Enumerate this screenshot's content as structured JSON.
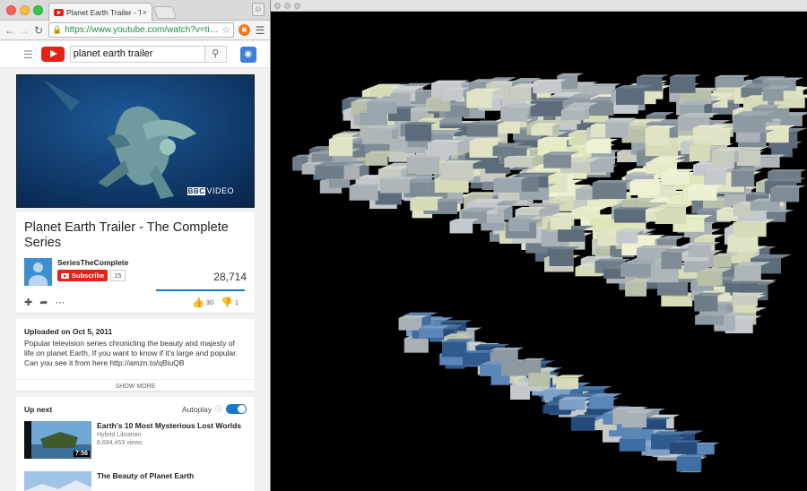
{
  "browser": {
    "tab_title": "Planet Earth Trailer - Th",
    "tab_close": "×",
    "url": "https://www.youtube.com/watch?v=ti…",
    "icons": [
      "back-icon",
      "forward-icon",
      "reload-icon",
      "lock-icon",
      "star-icon",
      "extension-icon",
      "menu-icon"
    ]
  },
  "youtube": {
    "search_value": "planet earth trailer",
    "player_watermark": "VIDEO",
    "player_brand": "BBC",
    "video_title": "Planet Earth Trailer - The Complete Series",
    "channel_name": "SeriesTheComplete",
    "subscribe_label": "Subscribe",
    "subscriber_count": "15",
    "view_count": "28,714",
    "like_count": "30",
    "dislike_count": "1",
    "upload_date": "Uploaded on Oct 5, 2011",
    "description": "Popular television series chronicling the beauty and majesty of life on planet Earth, If you want to know if it's large and popular. Can you see it from here http://amzn.to/qBiuQB",
    "show_more": "SHOW MORE",
    "up_next_label": "Up next",
    "autoplay_label": "Autoplay",
    "up_next": [
      {
        "title": "Earth's 10 Most Mysterious Lost Worlds",
        "channel": "Hybrid Librarian",
        "views": "6,694,453 views",
        "duration": "7:56"
      },
      {
        "title": "The Beauty of Planet Earth",
        "channel": "",
        "views": "",
        "duration": ""
      }
    ]
  },
  "colors": {
    "youtube_red": "#e62117",
    "link_blue": "#167ac6",
    "url_green": "#1e8e3e"
  }
}
